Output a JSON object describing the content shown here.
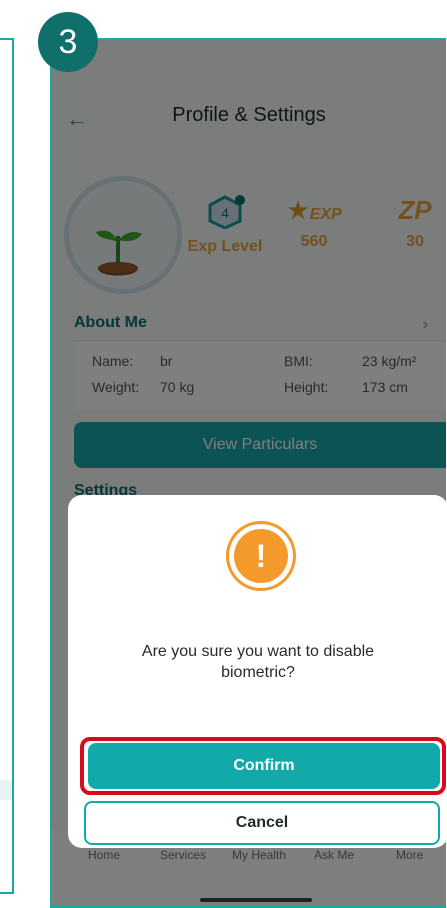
{
  "step_badge": "3",
  "header": {
    "title": "Profile & Settings"
  },
  "profile": {
    "stats": [
      {
        "icon": "level-badge-icon",
        "number": "4",
        "label": "Exp Level"
      },
      {
        "icon": "star-exp-icon",
        "word": "EXP",
        "label": "560"
      },
      {
        "icon": "zp-icon",
        "word": "ZP",
        "label": "30"
      }
    ]
  },
  "about": {
    "title": "About Me",
    "rows": [
      {
        "k1": "Name:",
        "v1": "br",
        "k2": "BMI:",
        "v2": "23 kg/m²"
      },
      {
        "k1": "Weight:",
        "v1": "70 kg",
        "k2": "Height:",
        "v2": "173 cm"
      }
    ],
    "view_button": "View Particulars"
  },
  "settings": {
    "title": "Settings"
  },
  "nav": [
    "Home",
    "Services",
    "My Health",
    "Ask Me",
    "More"
  ],
  "dialog": {
    "message": "Are you sure you want to disable biometric?",
    "confirm": "Confirm",
    "cancel": "Cancel"
  },
  "colors": {
    "teal": "#12a9a9",
    "orange": "#f39a2a",
    "highlight": "#d90a17"
  }
}
